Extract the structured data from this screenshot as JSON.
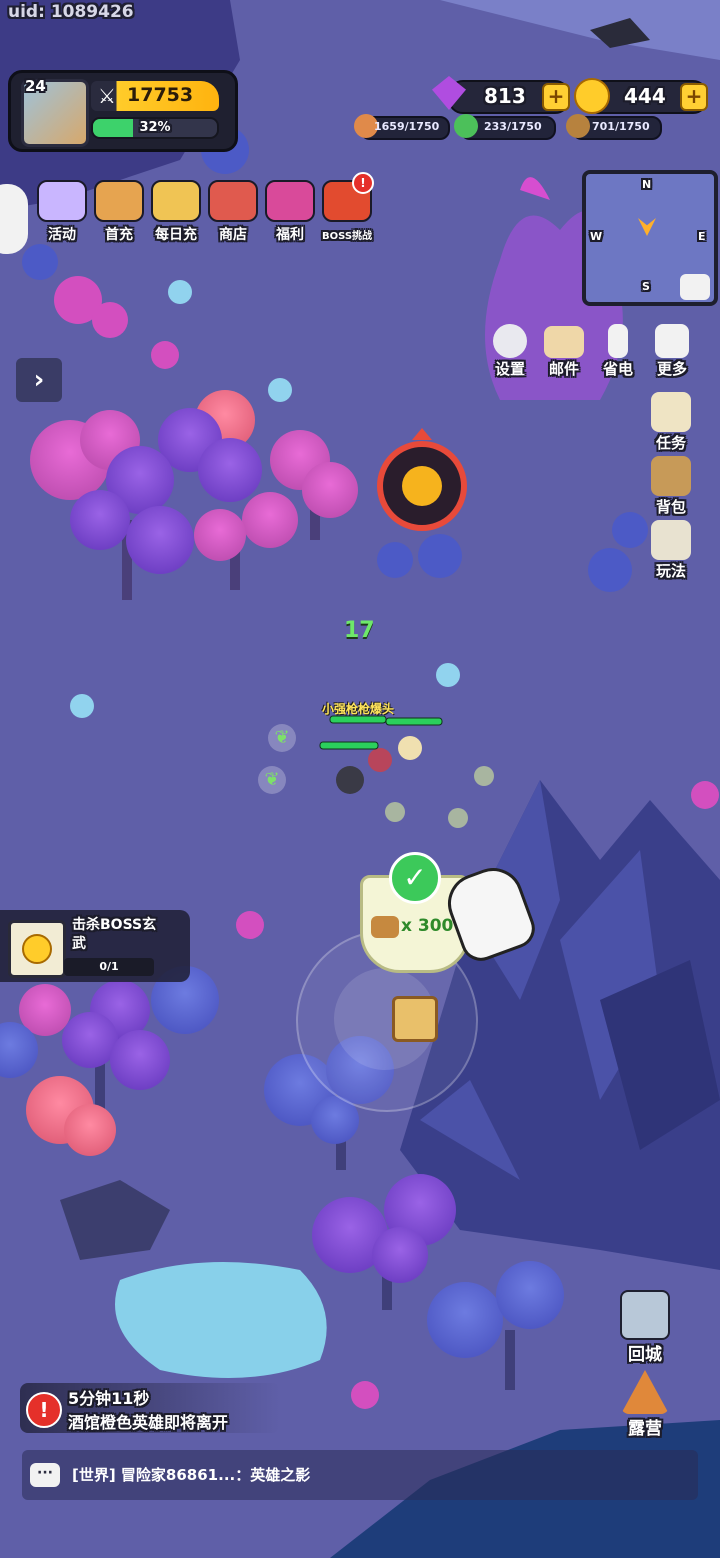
{
  "uid_label": "uid: 1089426",
  "player": {
    "level": "24",
    "power": "17753",
    "xp_percent": "32%",
    "xp_fraction": 0.32
  },
  "currency": {
    "gems": "813",
    "gold": "444"
  },
  "resources": {
    "meat": "1659/1750",
    "herb": "233/1750",
    "wood": "701/1750"
  },
  "top_menu": [
    {
      "label": "活动",
      "icon": "chest-icon",
      "color": "#c9b6ff"
    },
    {
      "label": "首充",
      "icon": "king-icon",
      "color": "#e6a450"
    },
    {
      "label": "每日充",
      "icon": "cart-icon",
      "color": "#f0c454"
    },
    {
      "label": "商店",
      "icon": "shop-icon",
      "color": "#e05a4e"
    },
    {
      "label": "福利",
      "icon": "gift-icon",
      "color": "#d94a9a"
    },
    {
      "label": "BOSS挑战",
      "icon": "boss-icon",
      "color": "#e24b2f"
    }
  ],
  "minimap": {
    "n": "N",
    "s": "S",
    "w": "W",
    "e": "E"
  },
  "system_menu": [
    {
      "label": "设置",
      "icon": "gear-icon"
    },
    {
      "label": "邮件",
      "icon": "mail-icon"
    },
    {
      "label": "省电",
      "icon": "battery-icon"
    },
    {
      "label": "更多",
      "icon": "grid-icon"
    }
  ],
  "side_menu": [
    {
      "label": "任务",
      "icon": "scroll-icon"
    },
    {
      "label": "背包",
      "icon": "backpack-icon"
    },
    {
      "label": "玩法",
      "icon": "helmet-icon"
    }
  ],
  "battle": {
    "damage_text": "17",
    "hero_name": "小强枪枪爆头"
  },
  "reward": {
    "amount": "x 300"
  },
  "quest": {
    "title": "击杀BOSS玄武",
    "progress": "0/1"
  },
  "notice": {
    "timer": "5分钟11秒",
    "message": "酒馆橙色英雄即将离开"
  },
  "bottom_right": [
    {
      "label": "回城",
      "icon": "portal-icon"
    },
    {
      "label": "露营",
      "icon": "tent-icon"
    }
  ],
  "chat": {
    "message": "[世界] 冒险家86861...：英雄之影"
  },
  "colors": {
    "ground": "#5f5fa8",
    "accent_gold": "#ffcc2a",
    "xp_green": "#3dd26b"
  }
}
